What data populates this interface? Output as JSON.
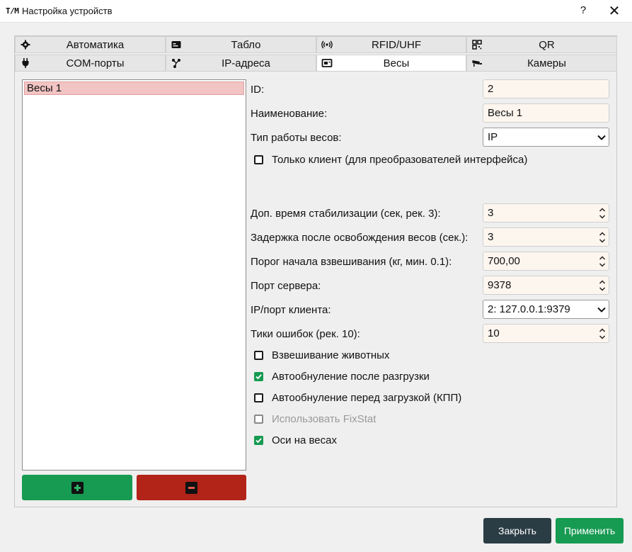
{
  "window": {
    "app_icon": "T/M",
    "title": "Настройка устройств",
    "help": "?",
    "close": "✕"
  },
  "tabs": [
    {
      "label": "Автоматика",
      "icon": "gear-icon"
    },
    {
      "label": "Табло",
      "icon": "display-icon"
    },
    {
      "label": "RFID/UHF",
      "icon": "rfid-icon"
    },
    {
      "label": "QR",
      "icon": "qr-icon"
    },
    {
      "label": "COM-порты",
      "icon": "plug-icon"
    },
    {
      "label": "IP-адреса",
      "icon": "network-icon"
    },
    {
      "label": "Весы",
      "icon": "scales-icon",
      "active": true
    },
    {
      "label": "Камеры",
      "icon": "camera-icon"
    }
  ],
  "device_list": {
    "items": [
      "Весы 1"
    ],
    "selected": "Весы 1"
  },
  "form": {
    "id_label": "ID:",
    "id_value": "2",
    "name_label": "Наименование:",
    "name_value": "Весы 1",
    "mode_label": "Тип работы весов:",
    "mode_value": "IP",
    "client_only_label": "Только клиент (для преобразователей интерфейса)",
    "client_only_checked": false,
    "stab_label": "Доп. время стабилизации (сек, рек. 3):",
    "stab_value": "3",
    "delay_label": "Задержка после освобождения весов (сек.):",
    "delay_value": "3",
    "threshold_label": "Порог начала взвешивания (кг, мин. 0.1):",
    "threshold_value": "700,00",
    "port_label": "Порт сервера:",
    "port_value": "9378",
    "client_label": "IP/порт клиента:",
    "client_value": "2: 127.0.0.1:9379",
    "errors_label": "Тики ошибок (рек. 10):",
    "errors_value": "10"
  },
  "checks": [
    {
      "label": "Взвешивание животных",
      "checked": false,
      "disabled": false
    },
    {
      "label": "Автообнуление после разгрузки",
      "checked": true,
      "disabled": false
    },
    {
      "label": "Автообнуление перед загрузкой (КПП)",
      "checked": false,
      "disabled": false
    },
    {
      "label": "Использовать FixStat",
      "checked": false,
      "disabled": true
    },
    {
      "label": "Оси на весах",
      "checked": true,
      "disabled": false
    }
  ],
  "buttons": {
    "close": "Закрыть",
    "apply": "Применить"
  },
  "colors": {
    "accent_green": "#179a52",
    "danger_red": "#b22318",
    "dark_button": "#2b3d44",
    "selection_pink": "#f2c4c4"
  }
}
